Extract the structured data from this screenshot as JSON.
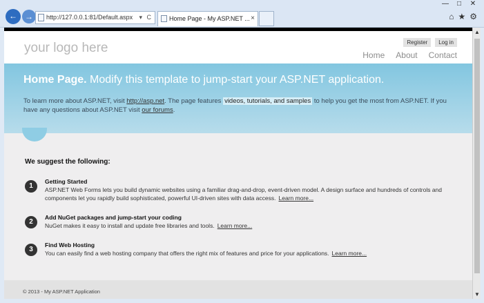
{
  "browser": {
    "address": "http://127.0.0.1:81/Default.aspx",
    "address_tools": "▾ C",
    "tab_title": "Home Page - My ASP.NET ...",
    "tab_close": "×",
    "window_buttons": [
      "—",
      "□",
      "✕"
    ],
    "icons": [
      "home-icon",
      "favorites-icon",
      "settings-icon"
    ]
  },
  "header": {
    "logo": "your logo here",
    "login_links": [
      "Register",
      "Log in"
    ],
    "menu": [
      "Home",
      "About",
      "Contact"
    ]
  },
  "featured": {
    "title_bold": "Home Page.",
    "title_rest": " Modify this template to jump-start your ASP.NET application.",
    "text_1": "To learn more about ASP.NET, visit ",
    "link_1": "http://asp.net",
    "text_2": ". The page features ",
    "highlight": "videos, tutorials, and samples",
    "text_3": " to help you get the most from ASP.NET. If you have any questions about ASP.NET visit ",
    "link_2": "our forums",
    "text_4": "."
  },
  "main": {
    "heading": "We suggest the following:",
    "items": [
      {
        "num": "1",
        "title": "Getting Started",
        "desc": "ASP.NET Web Forms lets you build dynamic websites using a familiar drag-and-drop, event-driven model. A design surface and hundreds of controls and components let you rapidly build sophisticated, powerful UI-driven sites with data access.",
        "link": "Learn more..."
      },
      {
        "num": "2",
        "title": "Add NuGet packages and jump-start your coding",
        "desc": "NuGet makes it easy to install and update free libraries and tools.",
        "link": "Learn more..."
      },
      {
        "num": "3",
        "title": "Find Web Hosting",
        "desc": "You can easily find a web hosting company that offers the right mix of features and price for your applications.",
        "link": "Learn more..."
      }
    ]
  },
  "footer": {
    "text": "© 2013 - My ASP.NET Application"
  }
}
